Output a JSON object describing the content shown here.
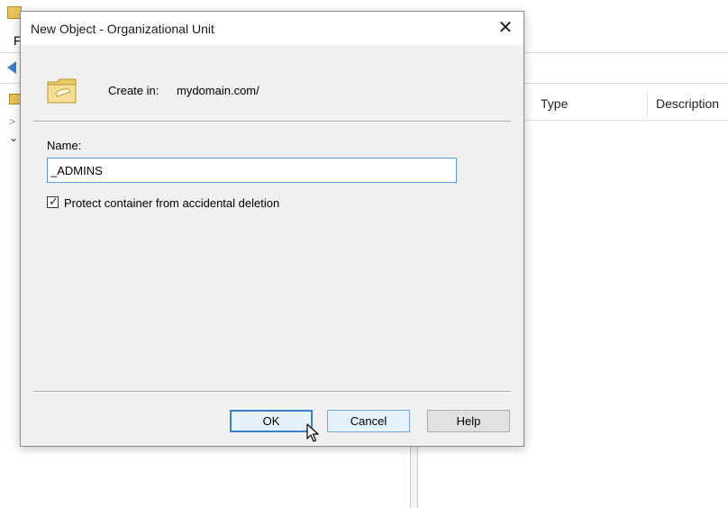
{
  "background_window": {
    "menu_first_letter": "F",
    "list_columns": [
      "Type",
      "Description"
    ]
  },
  "dialog": {
    "title": "New Object - Organizational Unit",
    "close_glyph": "✕",
    "create_in_label": "Create in:",
    "create_in_path": "mydomain.com/",
    "name_label": "Name:",
    "name_value": "_ADMINS",
    "protect_checkbox": {
      "label": "Protect container from accidental deletion",
      "checked": true
    },
    "buttons": {
      "ok": "OK",
      "cancel": "Cancel",
      "help": "Help"
    }
  },
  "icons": {
    "ou": "organizational-unit-folder-icon",
    "close": "close-icon",
    "back": "back-arrow-icon",
    "cursor": "mouse-pointer-icon"
  },
  "colors": {
    "dialog_bg": "#f0f0f0",
    "focus_blue": "#3c7fc9",
    "folder_yellow": "#f2d784"
  }
}
